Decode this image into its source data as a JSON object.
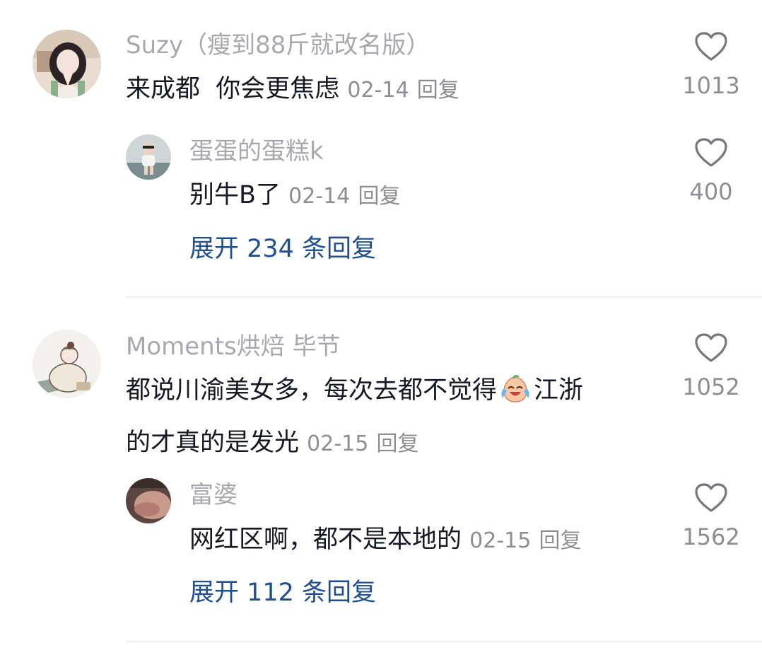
{
  "comments": [
    {
      "username": "Suzy（瘦到88斤就改名版）",
      "text": "来成都  你会更焦虑",
      "date": "02-14",
      "reply_label": "回复",
      "likes": "1013",
      "replies": [
        {
          "username": "蛋蛋的蛋糕k",
          "text": "别牛B了",
          "date": "02-14",
          "reply_label": "回复",
          "likes": "400"
        }
      ],
      "expand_label": "展开 234 条回复"
    },
    {
      "username": "Moments烘焙 毕节",
      "text_line1_a": "都说川渝美女多，每次去都不觉得",
      "text_line1_emoji": "crying-laughing-emoji",
      "text_line1_b": "江浙",
      "text_line2": "的才真的是发光",
      "date": "02-15",
      "reply_label": "回复",
      "likes": "1052",
      "replies": [
        {
          "username": "富婆",
          "text": "网红区啊，都不是本地的",
          "date": "02-15",
          "reply_label": "回复",
          "likes": "1562"
        }
      ],
      "expand_label": "展开 112 条回复"
    }
  ],
  "icons": {
    "like": "heart-outline-icon"
  },
  "colors": {
    "username": "#a7a9ae",
    "meta": "#8c8e93",
    "expand_link": "#1f4f8f",
    "text": "#161823"
  }
}
